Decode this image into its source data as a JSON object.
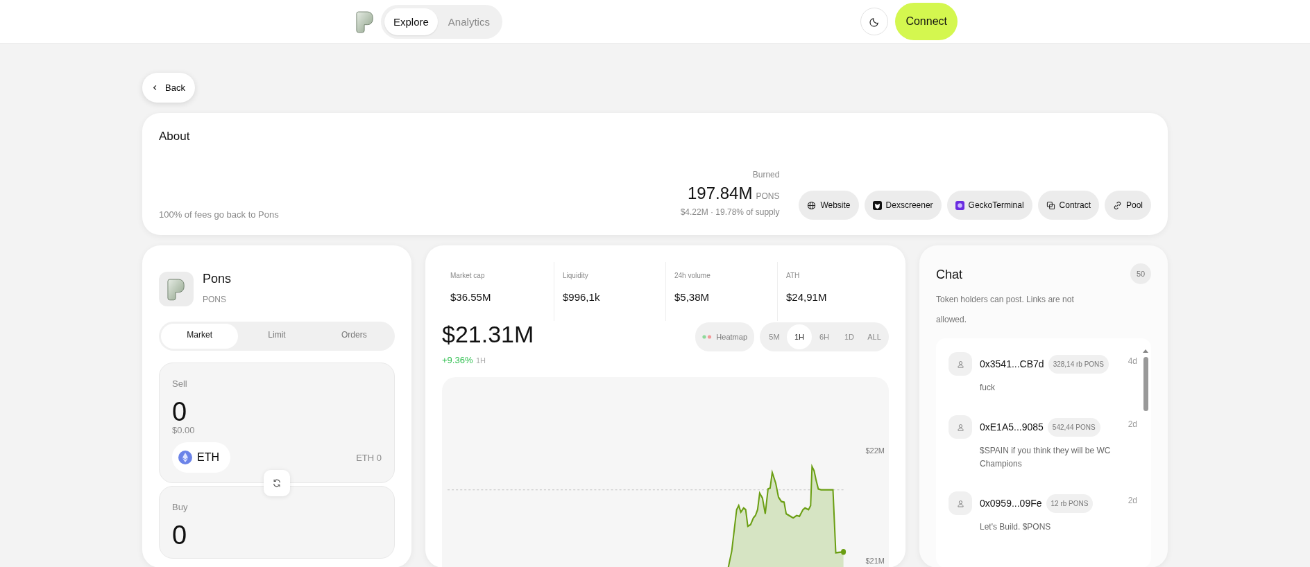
{
  "nav": {
    "tabs": [
      {
        "label": "Explore",
        "selected": true
      },
      {
        "label": "Analytics",
        "selected": false
      }
    ],
    "connect": "Connect"
  },
  "back": "Back",
  "about": {
    "title": "About",
    "description": "100% of fees go back to Pons",
    "burned_label": "Burned",
    "burned_amount": "197.84M",
    "burned_unit": "PONS",
    "burned_detail": "$4.22M · 19.78% of supply",
    "links": [
      {
        "kind": "globe",
        "label": "Website"
      },
      {
        "kind": "dex",
        "label": "Dexscreener"
      },
      {
        "kind": "gecko",
        "label": "GeckoTerminal"
      },
      {
        "kind": "copy",
        "label": "Contract"
      },
      {
        "kind": "link",
        "label": "Pool"
      }
    ]
  },
  "token": {
    "name": "Pons",
    "symbol": "PONS"
  },
  "trade_tabs": [
    {
      "label": "Market",
      "selected": true
    },
    {
      "label": "Limit",
      "selected": false
    },
    {
      "label": "Orders",
      "selected": false
    }
  ],
  "sell": {
    "label": "Sell",
    "amount": "0",
    "usd": "$0.00",
    "asset": "ETH",
    "balance": "ETH 0"
  },
  "buy": {
    "label": "Buy",
    "amount": "0"
  },
  "stats": [
    {
      "label": "Market cap",
      "value": "$36.55M"
    },
    {
      "label": "Liquidity",
      "value": "$996,1k"
    },
    {
      "label": "24h volume",
      "value": "$5,38M"
    },
    {
      "label": "ATH",
      "value": "$24,91M"
    }
  ],
  "price": {
    "value": "$21.31M",
    "change": "+9.36%",
    "period": "1H"
  },
  "heatmap": "Heatmap",
  "timeframes": [
    {
      "label": "5M",
      "selected": false
    },
    {
      "label": "1H",
      "selected": true
    },
    {
      "label": "6H",
      "selected": false
    },
    {
      "label": "1D",
      "selected": false
    },
    {
      "label": "ALL",
      "selected": false
    }
  ],
  "chart_axis": [
    "$22M",
    "$21M"
  ],
  "chat": {
    "title": "Chat",
    "count": "50",
    "note": "Token holders can post. Links are not allowed.",
    "messages": [
      {
        "address": "0x3541...CB7d",
        "balance": "328,14 rb PONS",
        "time": "4d",
        "text": "fuck"
      },
      {
        "address": "0xE1A5...9085",
        "balance": "542,44 PONS",
        "time": "2d",
        "text": "$SPAIN if you think they will be WC Champions"
      },
      {
        "address": "0x0959...09Fe",
        "balance": "12 rb PONS",
        "time": "2d",
        "text": "Let's Build. $PONS"
      }
    ]
  }
}
